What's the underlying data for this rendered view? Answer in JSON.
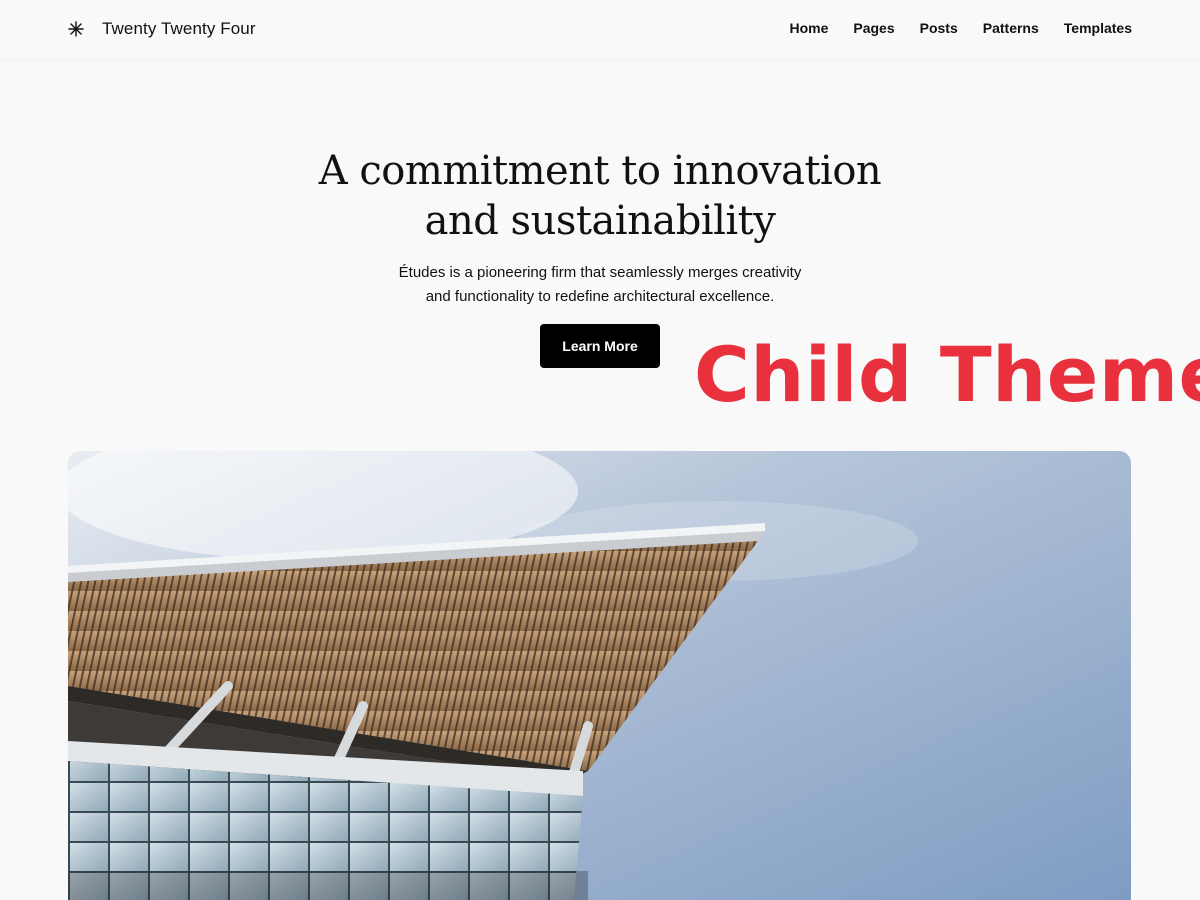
{
  "site": {
    "title": "Twenty Twenty Four",
    "logo_icon": "asterisk-icon"
  },
  "nav": {
    "items": [
      {
        "label": "Home"
      },
      {
        "label": "Pages"
      },
      {
        "label": "Posts"
      },
      {
        "label": "Patterns"
      },
      {
        "label": "Templates"
      }
    ]
  },
  "hero": {
    "title_line1": "A commitment to innovation",
    "title_line2": "and sustainability",
    "desc_line1": "Études is a pioneering firm that seamlessly merges creativity",
    "desc_line2": "and functionality to redefine architectural excellence.",
    "button_label": "Learn More",
    "image_subject": "modern-building-canopy-photo"
  },
  "overlay": {
    "label": "Child Theme",
    "color": "#e8313d"
  },
  "colors": {
    "background": "#f9f9f9",
    "text": "#111111",
    "button_bg": "#000000",
    "button_text": "#ffffff",
    "sky": "#8ba6c8"
  }
}
